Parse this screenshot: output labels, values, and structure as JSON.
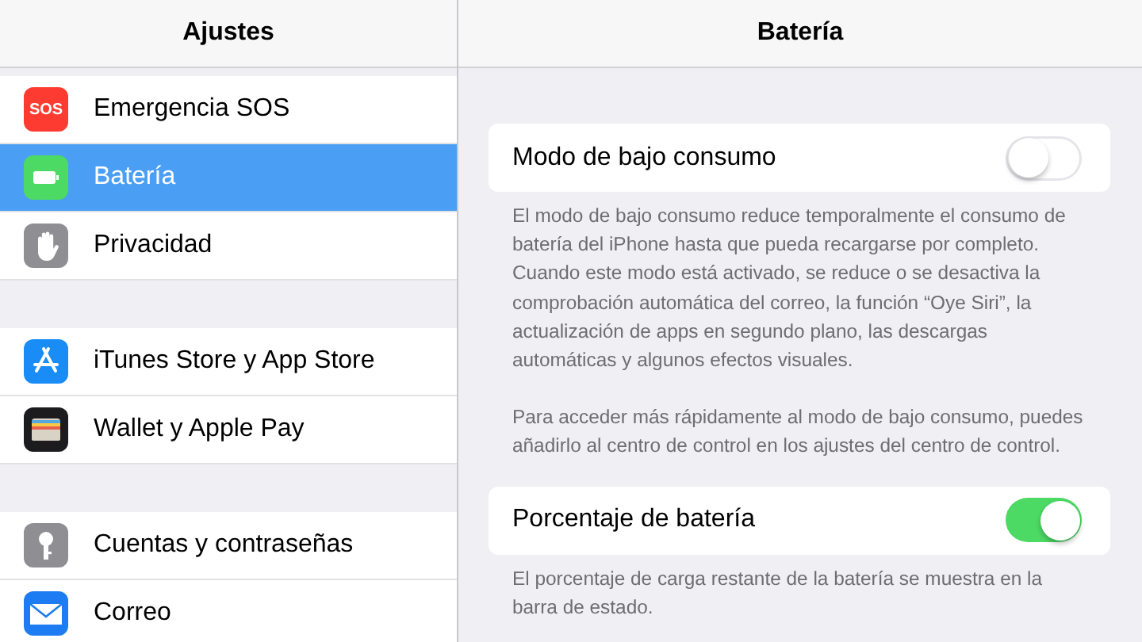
{
  "sidebar": {
    "title": "Ajustes",
    "groups": [
      {
        "items": [
          {
            "label": "Emergencia SOS",
            "kind": "sos",
            "icon_text": "SOS",
            "selected": false
          },
          {
            "label": "Batería",
            "kind": "battery",
            "selected": true
          },
          {
            "label": "Privacidad",
            "kind": "hand",
            "selected": false
          }
        ]
      },
      {
        "items": [
          {
            "label": "iTunes Store y App Store",
            "kind": "appstore",
            "selected": false
          },
          {
            "label": "Wallet y Apple Pay",
            "kind": "wallet",
            "selected": false
          }
        ]
      },
      {
        "items": [
          {
            "label": "Cuentas y contraseñas",
            "kind": "key",
            "selected": false
          },
          {
            "label": "Correo",
            "kind": "mail",
            "selected": false
          }
        ]
      }
    ]
  },
  "detail": {
    "title": "Batería",
    "sections": [
      {
        "label": "Modo de bajo consumo",
        "on": false,
        "footer": [
          "El modo de bajo consumo reduce temporalmente el consumo de batería del iPhone hasta que pueda recargarse por completo. Cuando este modo está activado, se reduce o se desactiva la comprobación automática del correo, la función “Oye Siri”, la actualización de apps en segundo plano, las descargas automáticas y algunos efectos visuales.",
          "Para acceder más rápidamente al modo de bajo consumo, puedes añadirlo al centro de control en los ajustes del centro de control."
        ]
      },
      {
        "label": "Porcentaje de batería",
        "on": true,
        "footer": [
          "El porcentaje de carga restante de la batería se muestra en la barra de estado."
        ]
      }
    ]
  }
}
